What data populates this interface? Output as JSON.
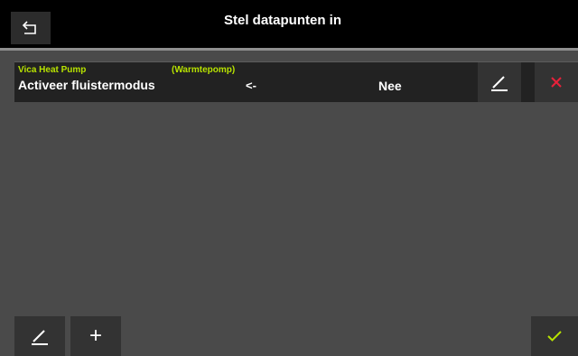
{
  "header": {
    "title": "Stel datapunten in",
    "back_icon": "back-arrow-icon"
  },
  "datapoints": [
    {
      "device": "Vica Heat Pump",
      "type": "(Warmtepomp)",
      "name": "Activeer fluistermodus",
      "direction": "<-",
      "value": "Nee",
      "edit_icon": "pencil-icon",
      "delete_icon": "close-icon"
    }
  ],
  "footer": {
    "edit_icon": "pencil-icon",
    "add_label": "+",
    "confirm_icon": "checkmark-icon"
  },
  "colors": {
    "accent": "#b8e300",
    "delete": "#e8213a",
    "background": "#4a4a4a",
    "header": "#000000"
  }
}
